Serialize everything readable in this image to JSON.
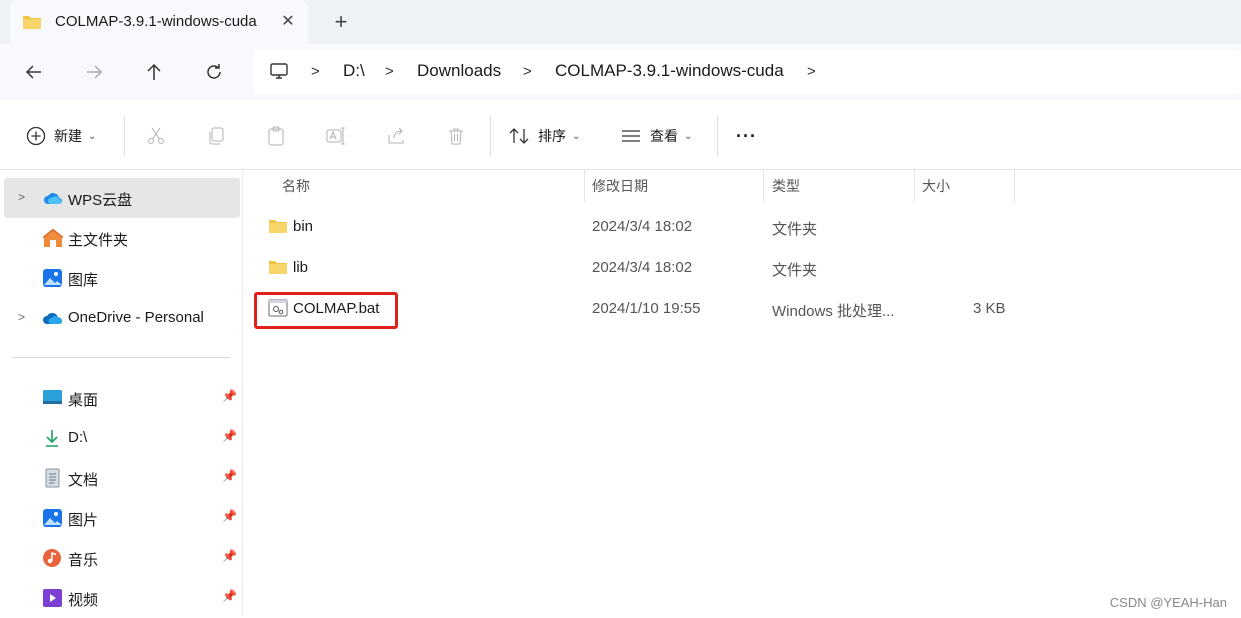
{
  "window": {
    "tab_title": "COLMAP-3.9.1-windows-cuda",
    "tab_close": "✕",
    "new_tab": "+"
  },
  "breadcrumb": [
    "D:\\",
    "Downloads",
    "COLMAP-3.9.1-windows-cuda"
  ],
  "toolbar": {
    "new_label": "新建",
    "sort_label": "排序",
    "view_label": "查看",
    "more_label": "···"
  },
  "sidebar": {
    "items": [
      {
        "label": "WPS云盘",
        "icon": "cloud-icon"
      },
      {
        "label": "主文件夹",
        "icon": "home-icon"
      },
      {
        "label": "图库",
        "icon": "gallery-icon"
      },
      {
        "label": "OneDrive - Personal",
        "icon": "onedrive-icon"
      }
    ],
    "quick_access": [
      {
        "label": "桌面",
        "icon": "desktop-icon"
      },
      {
        "label": "D:\\",
        "icon": "download-icon"
      },
      {
        "label": "文档",
        "icon": "document-icon"
      },
      {
        "label": "图片",
        "icon": "picture-icon"
      },
      {
        "label": "音乐",
        "icon": "music-icon"
      },
      {
        "label": "视频",
        "icon": "video-icon"
      }
    ]
  },
  "columns": {
    "name": "名称",
    "modified": "修改日期",
    "type": "类型",
    "size": "大小"
  },
  "files": [
    {
      "name": "bin",
      "modified": "2024/3/4 18:02",
      "type": "文件夹",
      "size": "",
      "icon": "folder-icon"
    },
    {
      "name": "lib",
      "modified": "2024/3/4 18:02",
      "type": "文件夹",
      "size": "",
      "icon": "folder-icon"
    },
    {
      "name": "COLMAP.bat",
      "modified": "2024/1/10 19:55",
      "type": "Windows 批处理...",
      "size": "3 KB",
      "icon": "batch-file-icon"
    }
  ],
  "colors": {
    "highlight": "#e0201b",
    "folder": "#f4c244",
    "accent": "#0f6cbd"
  },
  "watermark": "CSDN @YEAH-Han"
}
